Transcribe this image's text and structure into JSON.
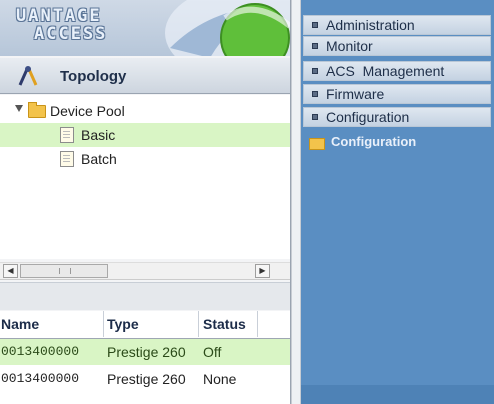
{
  "logo": {
    "line1": "UANTAGE",
    "line2": "ACCESS"
  },
  "topology": {
    "title": "Topology",
    "icon": "compass-icon"
  },
  "tree": {
    "items": [
      {
        "label": "Device Pool",
        "icon": "folder-icon",
        "expanded": true
      },
      {
        "label": "Basic",
        "icon": "document-icon",
        "selected": true
      },
      {
        "label": "Batch",
        "icon": "document-icon"
      }
    ]
  },
  "scrollbar": {
    "grip": "III"
  },
  "table": {
    "headers": [
      "Name",
      "Type",
      "Status"
    ],
    "rows": [
      [
        "0013400000",
        "Prestige 260",
        "Off"
      ],
      [
        "0013400000",
        "Prestige 260",
        "None"
      ]
    ]
  },
  "nav": {
    "items": [
      {
        "label": "Administration"
      },
      {
        "label": "Monitor"
      },
      {
        "label": "ACS  Management"
      },
      {
        "label": "Firmware"
      },
      {
        "label": "Configuration"
      }
    ],
    "open_section": {
      "label": "Configuration",
      "icon": "folder-open-icon"
    }
  },
  "colors": {
    "selected_row": "#d9f5c5",
    "nav_background": "#5a8ec2",
    "header_text": "#1f2f4a"
  }
}
